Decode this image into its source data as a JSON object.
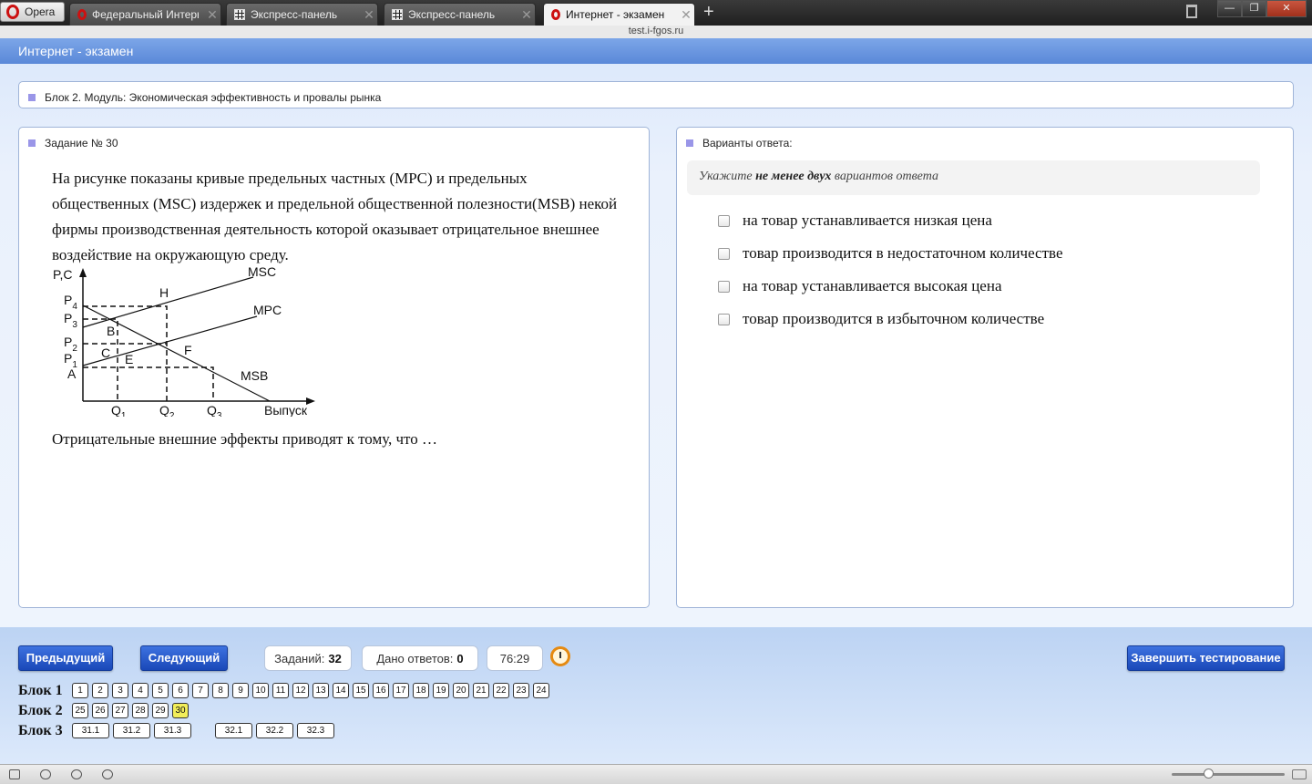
{
  "browser": {
    "menu_label": "Opera",
    "tabs": [
      {
        "title": "Федеральный Интерн...",
        "icon": "opera-icon"
      },
      {
        "title": "Экспресс-панель",
        "icon": "speed-dial-icon"
      },
      {
        "title": "Экспресс-панель",
        "icon": "speed-dial-icon"
      },
      {
        "title": "Интернет - экзамен",
        "icon": "opera-icon",
        "active": true
      }
    ],
    "close_glyph": "✕",
    "url": "test.i-fgos.ru"
  },
  "app": {
    "header_title": "Интернет - экзамен"
  },
  "block_title": "Блок 2. Модуль: Экономическая эффективность и провалы рынка",
  "question": {
    "title": "Задание № 30",
    "text": "На рисунке показаны кривые предельных частных (MPC) и предельных общественных (MSC) издержек и предельной общественной полезности(MSB) некой фирмы производственная деятельность которой оказывает отрицательное внешнее воздействие на окружающую среду.",
    "text_after": "Отрицательные внешние эффекты приводят к тому, что …",
    "graph": {
      "y_axis_label": "P,C",
      "x_axis_label": "Выпуск",
      "curves": [
        "MSC",
        "MPC",
        "MSB"
      ],
      "points": [
        "H",
        "B",
        "C",
        "E",
        "F"
      ],
      "y_ticks": [
        {
          "base": "P",
          "sub": "4"
        },
        {
          "base": "P",
          "sub": "3"
        },
        {
          "base": "P",
          "sub": "2"
        },
        {
          "base": "P",
          "sub": "1"
        },
        {
          "base": "A",
          "sub": ""
        }
      ],
      "x_ticks": [
        {
          "base": "Q",
          "sub": "1"
        },
        {
          "base": "Q",
          "sub": "2"
        },
        {
          "base": "Q",
          "sub": "3"
        }
      ]
    }
  },
  "answers": {
    "title": "Варианты ответа:",
    "hint_prefix": "Укажите ",
    "hint_bold": "не менее двух",
    "hint_suffix": " вариантов ответа",
    "options": [
      "на товар устанавливается низкая цена",
      "товар производится в недостаточном количестве",
      "на товар устанавливается высокая цена",
      "товар производится в избыточном количестве"
    ]
  },
  "footer": {
    "prev_label": "Предыдущий",
    "next_label": "Следующий",
    "finish_label": "Завершить тестирование",
    "tasks_label": "Заданий:",
    "tasks_value": "32",
    "answered_label": "Дано ответов:",
    "answered_value": "0",
    "timer": "76:29",
    "blocks": [
      {
        "label": "Блок 1",
        "items": [
          "1",
          "2",
          "3",
          "4",
          "5",
          "6",
          "7",
          "8",
          "9",
          "10",
          "11",
          "12",
          "13",
          "14",
          "15",
          "16",
          "17",
          "18",
          "19",
          "20",
          "21",
          "22",
          "23",
          "24"
        ]
      },
      {
        "label": "Блок 2",
        "items": [
          "25",
          "26",
          "27",
          "28",
          "29",
          "30"
        ],
        "current": "30"
      },
      {
        "label": "Блок 3",
        "items": [
          "31.1",
          "31.2",
          "31.3",
          "32.1",
          "32.2",
          "32.3"
        ]
      }
    ]
  }
}
